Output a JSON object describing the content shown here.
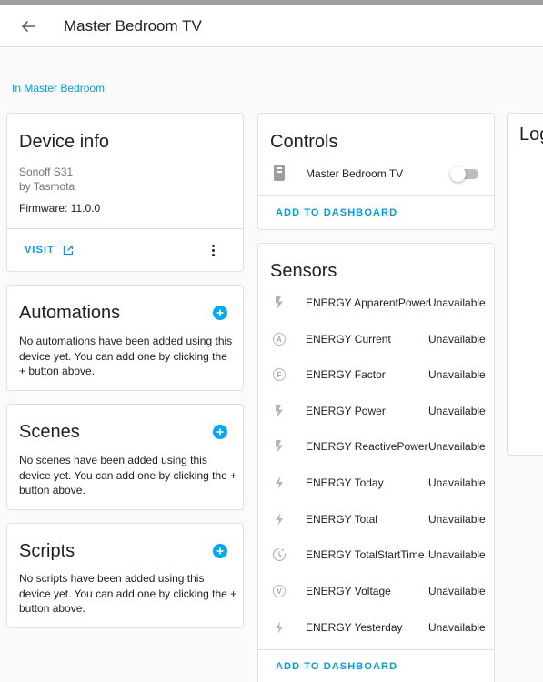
{
  "header": {
    "title": "Master Bedroom TV"
  },
  "breadcrumb": "In Master Bedroom",
  "device_info": {
    "title": "Device info",
    "model": "Sonoff S31",
    "manufacturer": "by Tasmota",
    "firmware": "Firmware: 11.0.0",
    "visit_label": "VISIT"
  },
  "automations": {
    "title": "Automations",
    "text": "No automations have been added using this device yet. You can add one by clicking the + button above."
  },
  "scenes": {
    "title": "Scenes",
    "text": "No scenes have been added using this device yet. You can add one by clicking the + button above."
  },
  "scripts": {
    "title": "Scripts",
    "text": "No scripts have been added using this device yet. You can add one by clicking the + button above."
  },
  "controls": {
    "title": "Controls",
    "entity_name": "Master Bedroom TV",
    "switch_on": false,
    "add_to_dashboard": "ADD TO DASHBOARD"
  },
  "sensors": {
    "title": "Sensors",
    "add_to_dashboard": "ADD TO DASHBOARD",
    "rows": [
      {
        "name": "ENERGY ApparentPower",
        "state": "Unavailable",
        "icon": "flash-icon"
      },
      {
        "name": "ENERGY Current",
        "state": "Unavailable",
        "icon": "current-a-icon"
      },
      {
        "name": "ENERGY Factor",
        "state": "Unavailable",
        "icon": "power-factor-icon"
      },
      {
        "name": "ENERGY Power",
        "state": "Unavailable",
        "icon": "flash-icon"
      },
      {
        "name": "ENERGY ReactivePower",
        "state": "Unavailable",
        "icon": "flash-icon"
      },
      {
        "name": "ENERGY Today",
        "state": "Unavailable",
        "icon": "lightning-bolt-icon"
      },
      {
        "name": "ENERGY Total",
        "state": "Unavailable",
        "icon": "lightning-bolt-icon"
      },
      {
        "name": "ENERGY TotalStartTime",
        "state": "Unavailable",
        "icon": "clock-icon"
      },
      {
        "name": "ENERGY Voltage",
        "state": "Unavailable",
        "icon": "voltage-v-icon"
      },
      {
        "name": "ENERGY Yesterday",
        "state": "Unavailable",
        "icon": "lightning-bolt-icon"
      }
    ]
  },
  "logbook": {
    "title": "Logbook"
  },
  "colors": {
    "accent": "#03a9f4",
    "link": "#039be5",
    "icon_grey": "#b7b7b7"
  }
}
